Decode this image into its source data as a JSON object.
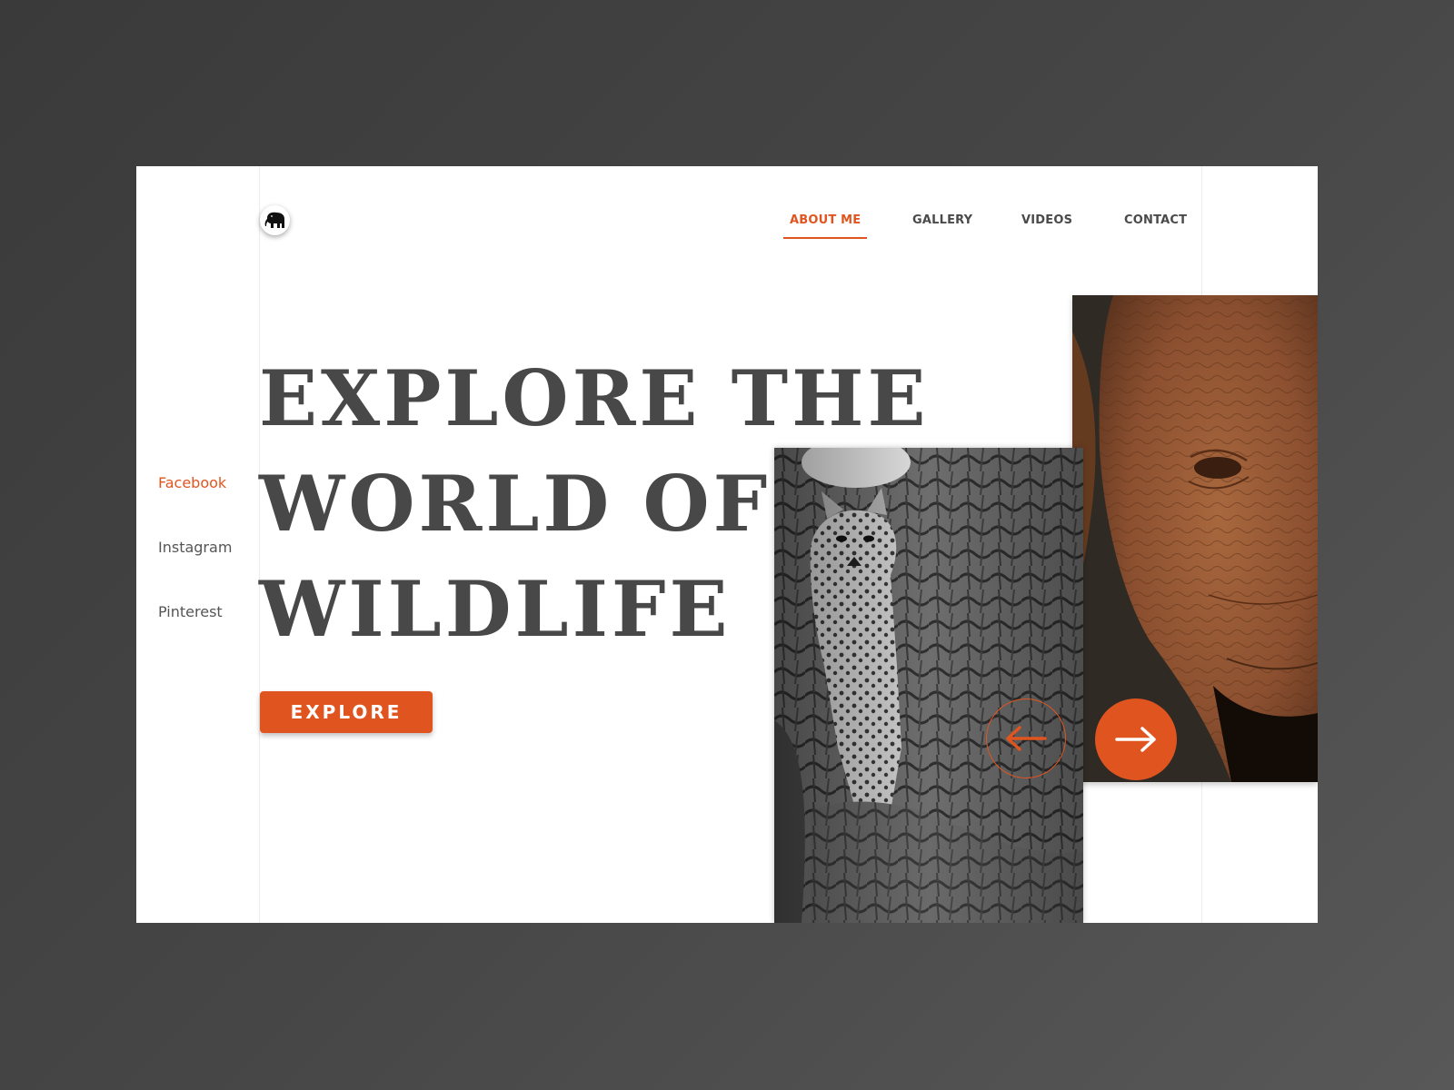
{
  "nav": {
    "items": [
      {
        "label": "ABOUT ME",
        "active": true
      },
      {
        "label": "GALLERY",
        "active": false
      },
      {
        "label": "VIDEOS",
        "active": false
      },
      {
        "label": "CONTACT",
        "active": false
      }
    ]
  },
  "social": {
    "links": [
      {
        "label": "Facebook",
        "active": true
      },
      {
        "label": "Instagram",
        "active": false
      },
      {
        "label": "Pinterest",
        "active": false
      }
    ]
  },
  "hero": {
    "headline_lines": [
      "EXPLORE THE",
      "WORLD OF",
      "WILDLIFE"
    ],
    "cta_label": "EXPLORE"
  },
  "slider": {
    "slides": [
      {
        "subject": "elephant",
        "tone": "color"
      },
      {
        "subject": "leopard",
        "tone": "black-and-white"
      }
    ]
  },
  "icons": {
    "logo": "elephant-icon",
    "prev": "arrow-left-icon",
    "next": "arrow-right-icon"
  },
  "colors": {
    "accent": "#e0551f",
    "text": "#484848",
    "background": "#ffffff",
    "frame": "#3e3e3e"
  }
}
